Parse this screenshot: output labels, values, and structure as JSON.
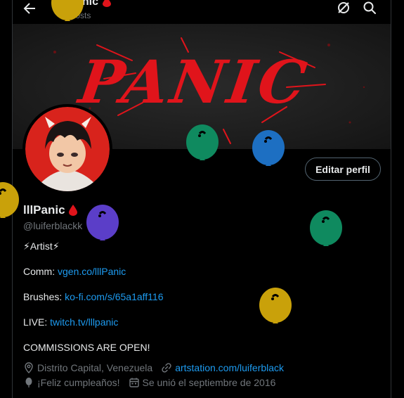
{
  "header": {
    "title": "lllPanic",
    "post_count": "62 posts"
  },
  "banner": {
    "art_text": "PANIC",
    "color": "#e0141b"
  },
  "profile": {
    "display_name": "lllPanic",
    "handle": "@luiferblackk",
    "edit_button": "Editar perfil",
    "bio": {
      "tagline": "⚡Artist⚡",
      "comm_label": "Comm: ",
      "comm_link": "vgen.co/lllPanic",
      "brushes_label": "Brushes: ",
      "brushes_link": "ko-fi.com/s/65a1aff116",
      "live_label": "LIVE: ",
      "live_link": "twitch.tv/lllpanic",
      "status": "COMMISSIONS ARE OPEN!"
    },
    "meta": {
      "location": "Distrito Capital, Venezuela",
      "website": "artstation.com/luiferblack",
      "birthday": "¡Feliz cumpleaños!",
      "joined": "Se unió el septiembre de 2016"
    }
  },
  "icons": {
    "back": "arrow-left-icon",
    "grok": "grok-icon",
    "search": "search-icon",
    "drop": "blood-drop-icon",
    "location": "location-pin-icon",
    "link": "link-icon",
    "birthday": "balloon-icon",
    "calendar": "calendar-icon"
  },
  "colors": {
    "link": "#1d9bf0",
    "muted": "#71767b",
    "text": "#e7e9ea",
    "balloon_yellow": "#c9a10a",
    "balloon_green": "#0f8a5f",
    "balloon_blue": "#1d6fc2",
    "balloon_purple": "#5b3ec8"
  }
}
